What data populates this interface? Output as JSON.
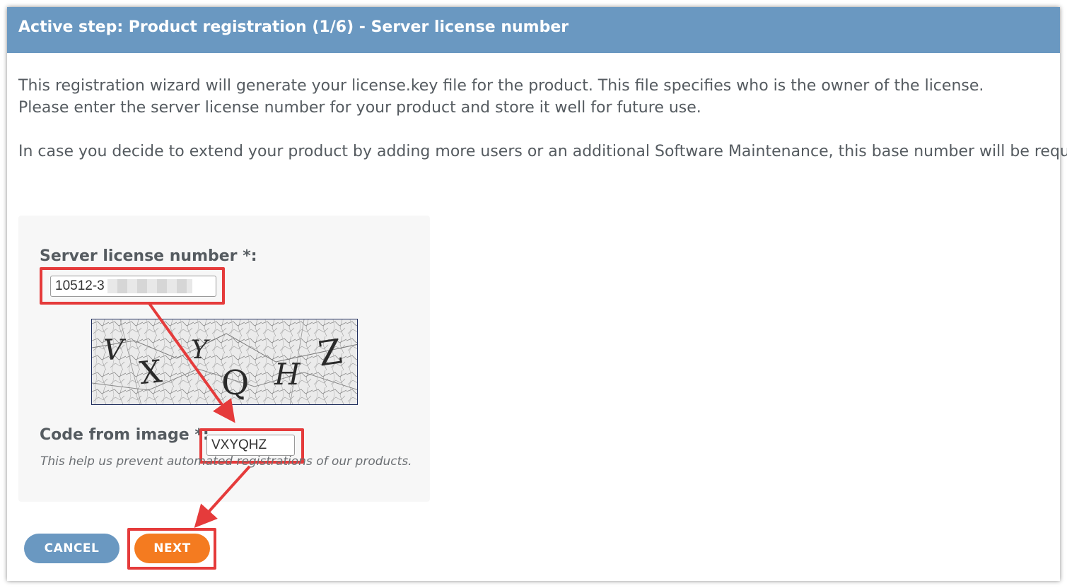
{
  "header": {
    "title": "Active step: Product registration (1/6) - Server license number"
  },
  "intro": {
    "line1": "This registration wizard will generate your license.key file for the product. This file specifies who is the owner of the license.",
    "line2": "Please enter the server license number for your product and store it well for future use.",
    "line3": "In case you decide to extend your product by adding more users or an additional Software Maintenance, this base number will be required."
  },
  "form": {
    "license_label": "Server license number *:",
    "license_value": "10512-3",
    "captcha_text": [
      "V",
      "X",
      "Y",
      "Q",
      "H",
      "Z"
    ],
    "code_label": "Code from image *:",
    "code_value": "VXYQHZ",
    "hint": "This help us prevent automated registrations of our products."
  },
  "buttons": {
    "cancel_label": "CANCEL",
    "next_label": "NEXT"
  },
  "colors": {
    "header_bg": "#6a98c1",
    "cancel_bg": "#6a98c1",
    "next_bg": "#f47b20",
    "annotation_red": "#e53b3b"
  }
}
